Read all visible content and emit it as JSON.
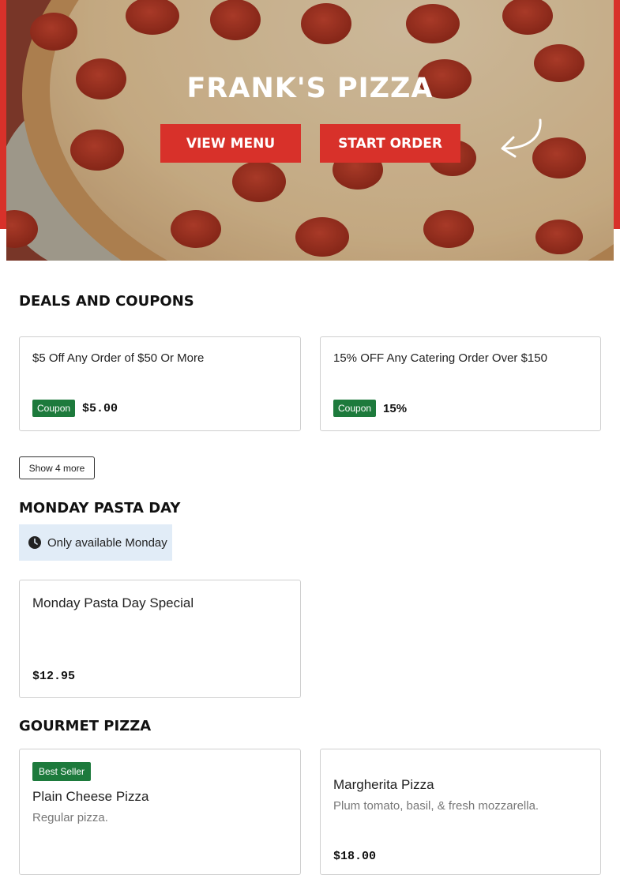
{
  "hero": {
    "title": "FRANK'S PIZZA",
    "view_menu_label": "VIEW MENU",
    "start_order_label": "START ORDER",
    "accent_color": "#d8312a"
  },
  "deals": {
    "heading": "DEALS AND COUPONS",
    "coupons": [
      {
        "title": "$5 Off Any Order of $50 Or More",
        "badge": "Coupon",
        "value": "$5.00"
      },
      {
        "title": "15% OFF Any Catering Order Over $150",
        "badge": "Coupon",
        "value": "15%"
      }
    ],
    "show_more_label": "Show 4 more"
  },
  "pasta": {
    "heading": "MONDAY PASTA DAY",
    "availability": "Only available Monday",
    "items": [
      {
        "title": "Monday Pasta Day Special",
        "price": "$12.95"
      }
    ]
  },
  "gourmet": {
    "heading": "GOURMET PIZZA",
    "items": [
      {
        "badge": "Best Seller",
        "title": "Plain Cheese Pizza",
        "description": "Regular pizza."
      },
      {
        "title": "Margherita Pizza",
        "description": "Plum tomato, basil, & fresh mozzarella.",
        "price": "$18.00"
      }
    ]
  },
  "icons": {
    "clock": "clock-icon",
    "arrow": "curved-arrow-icon"
  },
  "colors": {
    "badge_green": "#1d7a3c",
    "availability_bg": "#e1ecf7"
  }
}
